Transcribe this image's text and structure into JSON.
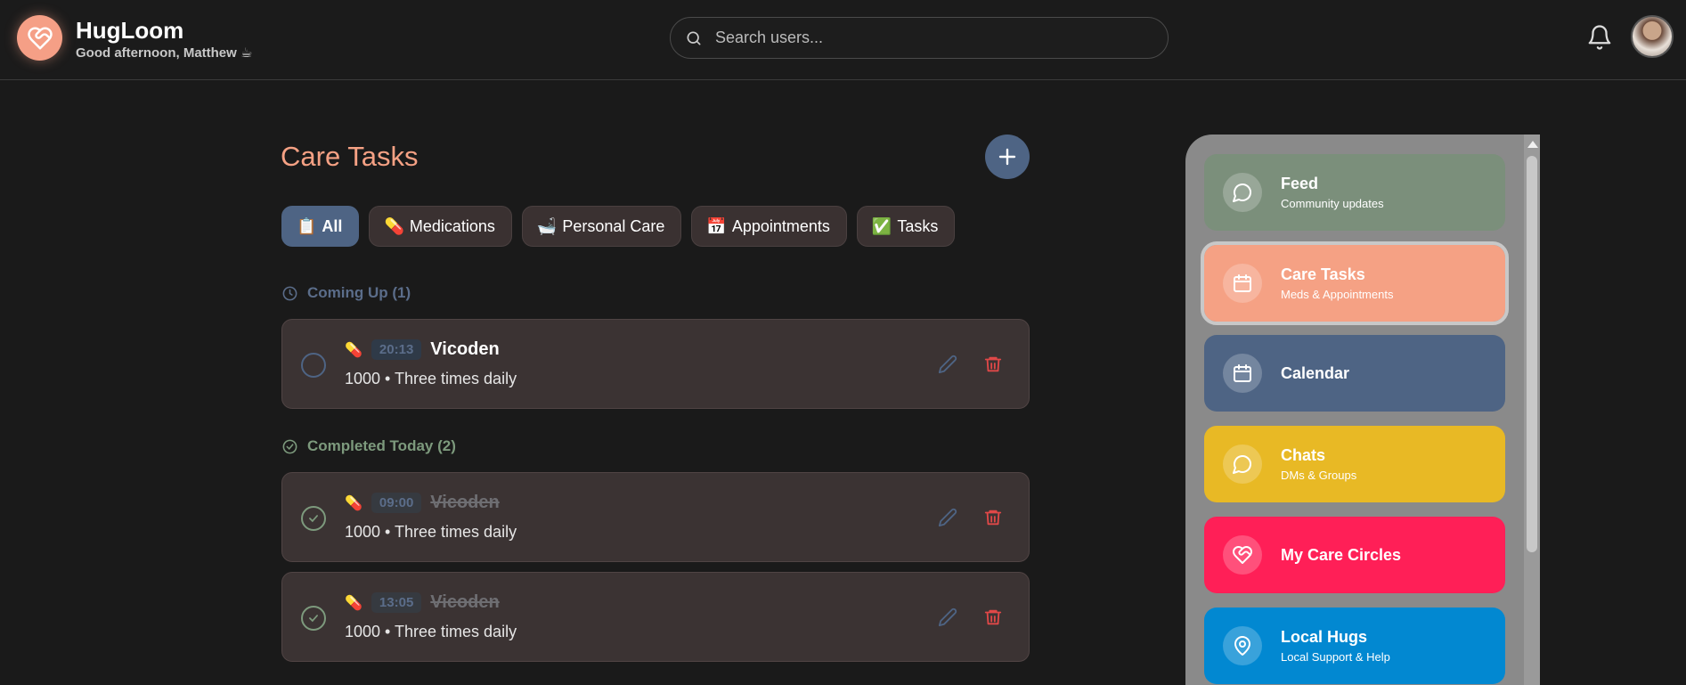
{
  "header": {
    "app_name": "HugLoom",
    "greeting": "Good afternoon, Matthew ☕",
    "search_placeholder": "Search users...",
    "icons": {
      "logo": "heart-handshake-icon",
      "search": "search-icon",
      "notifications": "bell-icon",
      "avatar": "user-avatar"
    }
  },
  "main": {
    "title": "Care Tasks",
    "add_button": "+",
    "filters": [
      {
        "emoji": "📋",
        "label": "All",
        "active": true
      },
      {
        "emoji": "💊",
        "label": "Medications",
        "active": false
      },
      {
        "emoji": "🛁",
        "label": "Personal Care",
        "active": false
      },
      {
        "emoji": "📅",
        "label": "Appointments",
        "active": false
      },
      {
        "emoji": "✅",
        "label": "Tasks",
        "active": false
      }
    ],
    "upcoming_label": "Coming Up (1)",
    "completed_label": "Completed Today (2)",
    "tasks": [
      {
        "emoji": "💊",
        "time": "20:13",
        "name": "Vicoden",
        "detail": "1000 • Three times daily",
        "completed": false
      },
      {
        "emoji": "💊",
        "time": "09:00",
        "name": "Vicoden",
        "detail": "1000 • Three times daily",
        "completed": true
      },
      {
        "emoji": "💊",
        "time": "13:05",
        "name": "Vicoden",
        "detail": "1000 • Three times daily",
        "completed": true
      }
    ]
  },
  "nav": [
    {
      "title": "Feed",
      "subtitle": "Community updates",
      "color": "#7b8f7b",
      "icon": "chat-bubble-icon"
    },
    {
      "title": "Care Tasks",
      "subtitle": "Meds & Appointments",
      "color": "#f5a184",
      "icon": "calendar-icon",
      "selected": true
    },
    {
      "title": "Calendar",
      "subtitle": "",
      "color": "#4e6484",
      "icon": "calendar-icon"
    },
    {
      "title": "Chats",
      "subtitle": "DMs & Groups",
      "color": "#e8b925",
      "icon": "chat-bubble-icon"
    },
    {
      "title": "My Care Circles",
      "subtitle": "",
      "color": "#ff1f57",
      "icon": "heart-handshake-icon"
    },
    {
      "title": "Local Hugs",
      "subtitle": "Local Support & Help",
      "color": "#0288d1",
      "icon": "map-pin-icon"
    }
  ],
  "colors": {
    "accent": "#f5a184",
    "primary": "#4e6484",
    "danger": "#e04848",
    "success": "#7d9a7d"
  }
}
